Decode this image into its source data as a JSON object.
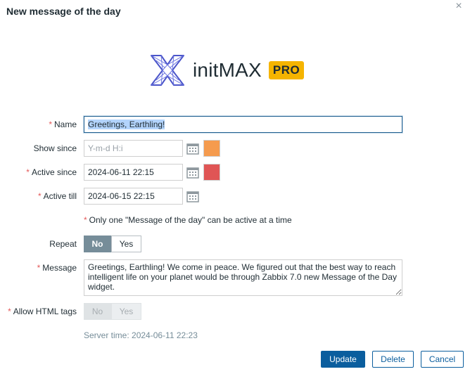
{
  "dialog": {
    "title": "New message of the day",
    "close_glyph": "×"
  },
  "logo": {
    "icon": "initmax-logo-icon",
    "text": "initMAX",
    "badge": "PRO",
    "badge_color": "#f5b400"
  },
  "form": {
    "name": {
      "label": "Name",
      "required": "*",
      "value": "Greetings, Earthling!"
    },
    "show_since": {
      "label": "Show since",
      "placeholder": "Y-m-d H:i",
      "color": "#f59b4e"
    },
    "active_since": {
      "label": "Active since",
      "required": "*",
      "value": "2024-06-11 22:15",
      "color": "#e05555"
    },
    "active_till": {
      "label": "Active till",
      "required": "*",
      "value": "2024-06-15 22:15"
    },
    "note": {
      "required": "*",
      "text": "Only one \"Message of the day\" can be active at a time"
    },
    "repeat": {
      "label": "Repeat",
      "options": [
        "No",
        "Yes"
      ],
      "selected": "No"
    },
    "message": {
      "label": "Message",
      "required": "*",
      "value": "Greetings, Earthling! We come in peace. We figured out that the best way to reach intelligent life on your planet would be through Zabbix 7.0 new Message of the Day widget."
    },
    "allow_html": {
      "label": "Allow HTML tags",
      "required": "*",
      "options": [
        "No",
        "Yes"
      ],
      "selected": "No",
      "disabled": true
    },
    "server_time": "Server time: 2024-06-11 22:23"
  },
  "buttons": {
    "update": "Update",
    "delete": "Delete",
    "cancel": "Cancel"
  },
  "colors": {
    "primary": "#0b5e9e",
    "required": "#e45959"
  }
}
